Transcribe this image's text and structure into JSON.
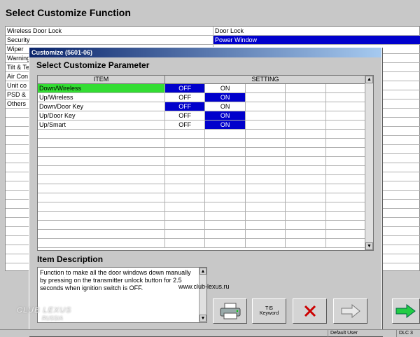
{
  "main": {
    "title": "Select Customize Function",
    "left_items": [
      "Wireless Door Lock",
      "Security",
      "Wiper",
      "Warning",
      "Tilt & Te",
      "Air Con",
      "Unit co",
      "PSD &",
      "Others"
    ],
    "right_items": [
      "Door Lock",
      "Power Window"
    ],
    "selected_right_index": 1
  },
  "dialog": {
    "title": "Customize (5601-06)",
    "subtitle": "Select Customize Parameter",
    "table": {
      "col_item": "ITEM",
      "col_setting": "SETTING",
      "rows": [
        {
          "item": "Down/Wireless",
          "off": "OFF",
          "on": "ON",
          "selected": "off",
          "highlight": true
        },
        {
          "item": "Up/Wireless",
          "off": "OFF",
          "on": "ON",
          "selected": "on",
          "highlight": false
        },
        {
          "item": "Down/Door Key",
          "off": "OFF",
          "on": "ON",
          "selected": "off",
          "highlight": false
        },
        {
          "item": "Up/Door Key",
          "off": "OFF",
          "on": "ON",
          "selected": "on",
          "highlight": false
        },
        {
          "item": "Up/Smart",
          "off": "OFF",
          "on": "ON",
          "selected": "on",
          "highlight": false
        }
      ],
      "empty_rows": 13
    },
    "description_title": "Item Description",
    "description_text": "Function to make all the door windows down manually by pressing on the transmitter unlock button for 2.5 seconds when ignition switch is OFF.",
    "buttons": {
      "tis_label_1": "TIS",
      "tis_label_2": "Keyword"
    }
  },
  "watermark": "www.club-lexus.ru",
  "logo_text": "CLUB LEXUS",
  "logo_sub": "RUSSIA",
  "status": {
    "user": "Default User",
    "port": "DLC 3"
  },
  "colors": {
    "selection_blue": "#0000cc",
    "highlight_green": "#33dd33",
    "cancel_red": "#cc0000"
  }
}
